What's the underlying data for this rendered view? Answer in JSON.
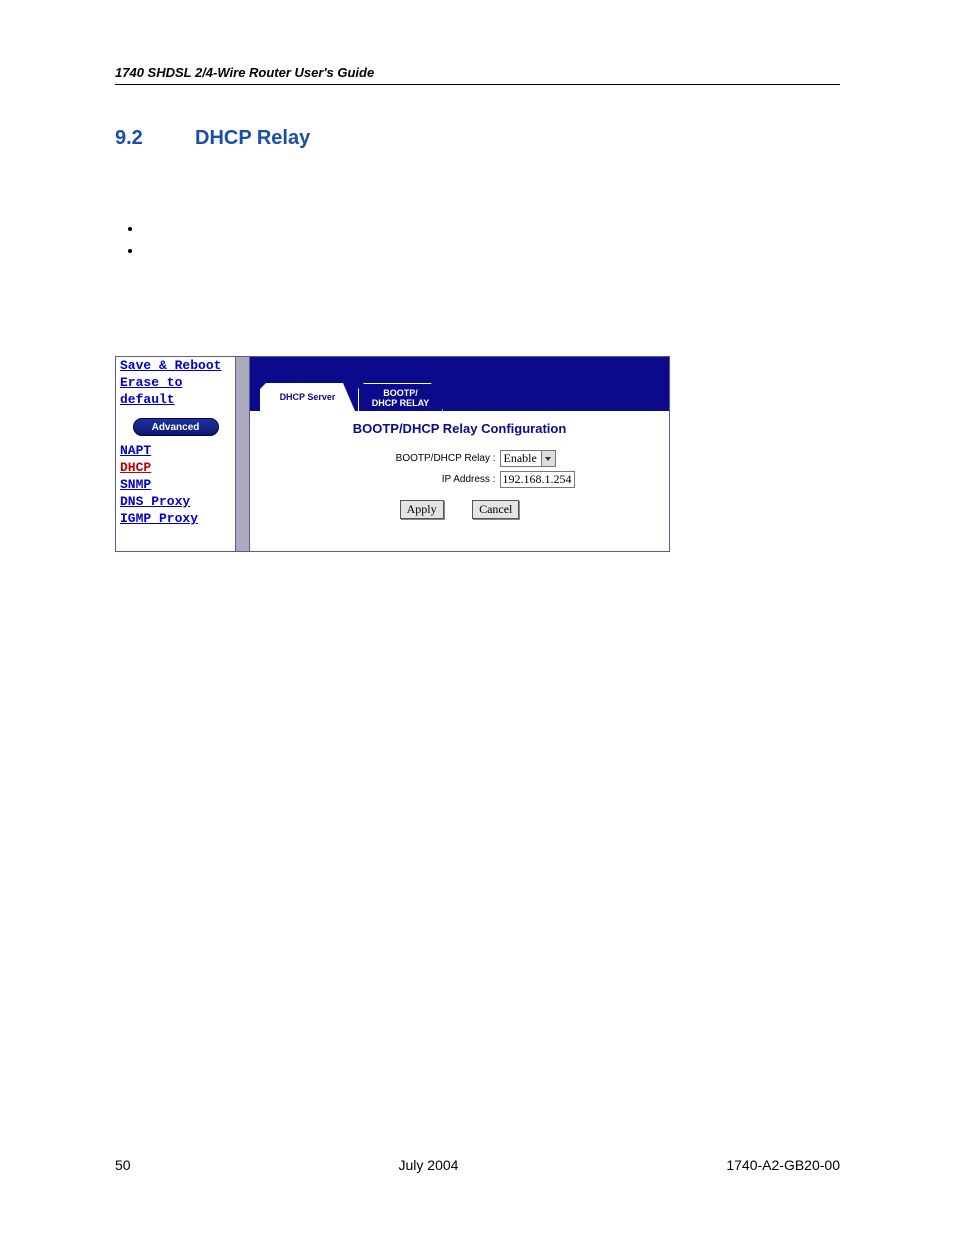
{
  "header": {
    "running": "1740 SHDSL 2/4-Wire Router User's Guide"
  },
  "section": {
    "number": "9.2",
    "title": "DHCP Relay"
  },
  "sidebar": {
    "top_links": [
      "Save & Reboot",
      "Erase to default"
    ],
    "advanced_label": "Advanced",
    "menu": [
      "NAPT",
      "DHCP",
      "SNMP",
      "DNS Proxy",
      "IGMP Proxy"
    ],
    "active": "DHCP"
  },
  "tabs": {
    "inactive": "DHCP Server",
    "active_line1": "BOOTP/",
    "active_line2": "DHCP RELAY"
  },
  "panel": {
    "title": "BOOTP/DHCP Relay Configuration",
    "relay_label": "BOOTP/DHCP Relay :",
    "relay_value": "Enable",
    "ip_label": "IP Address :",
    "ip_value": "192.168.1.254",
    "apply": "Apply",
    "cancel": "Cancel"
  },
  "footer": {
    "page": "50",
    "date": "July 2004",
    "docnum": "1740-A2-GB20-00"
  }
}
